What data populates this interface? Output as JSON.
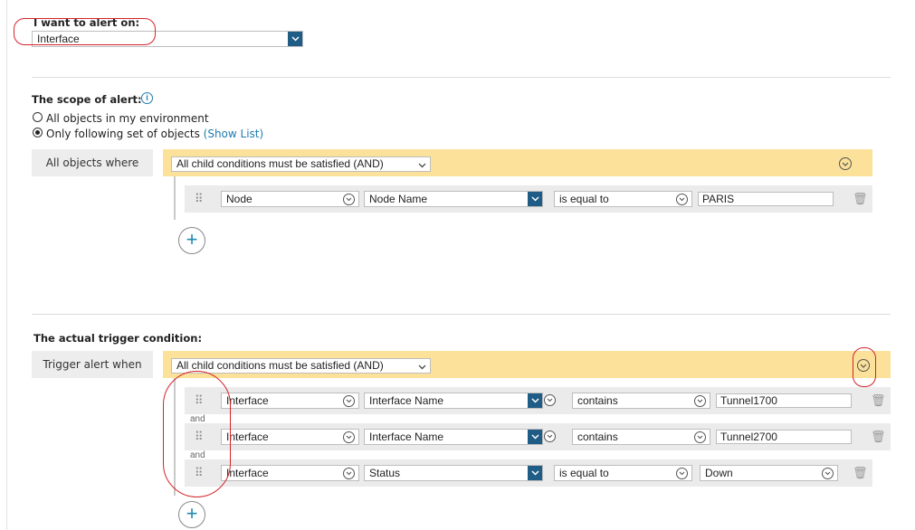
{
  "alert_on": {
    "label": "I want to alert on:",
    "selected": "Interface"
  },
  "scope": {
    "title": "The scope of alert:",
    "options": [
      {
        "label": "All objects in my environment",
        "selected": false
      },
      {
        "label": "Only following set of objects",
        "selected": true
      }
    ],
    "show_list_link": "(Show List)",
    "row_label": "All objects where",
    "group_mode": "All child conditions must be satisfied (AND)",
    "conditions": [
      {
        "type": "Node",
        "field": "Node Name",
        "operator": "is equal to",
        "value": "PARIS"
      }
    ]
  },
  "trigger": {
    "title": "The actual trigger condition:",
    "row_label": "Trigger alert when",
    "group_mode": "All child conditions must be satisfied (AND)",
    "joiner": "and",
    "conditions": [
      {
        "type": "Interface",
        "field": "Interface Name",
        "operator": "contains",
        "value": "Tunnel1700"
      },
      {
        "type": "Interface",
        "field": "Interface Name",
        "operator": "contains",
        "value": "Tunnel2700"
      },
      {
        "type": "Interface",
        "field": "Status",
        "operator": "is equal to",
        "value": "Down"
      }
    ]
  },
  "icons": {
    "info": "info-icon",
    "grip": "drag-handle-icon",
    "trash": "trash-icon",
    "plus": "add-condition-icon",
    "chevron": "chevron-down-icon"
  },
  "colors": {
    "accent_blue": "#1f5d86",
    "link_blue": "#1f7bb0",
    "group_yellow": "#fbe19a",
    "annotation_red": "#d3242b"
  }
}
